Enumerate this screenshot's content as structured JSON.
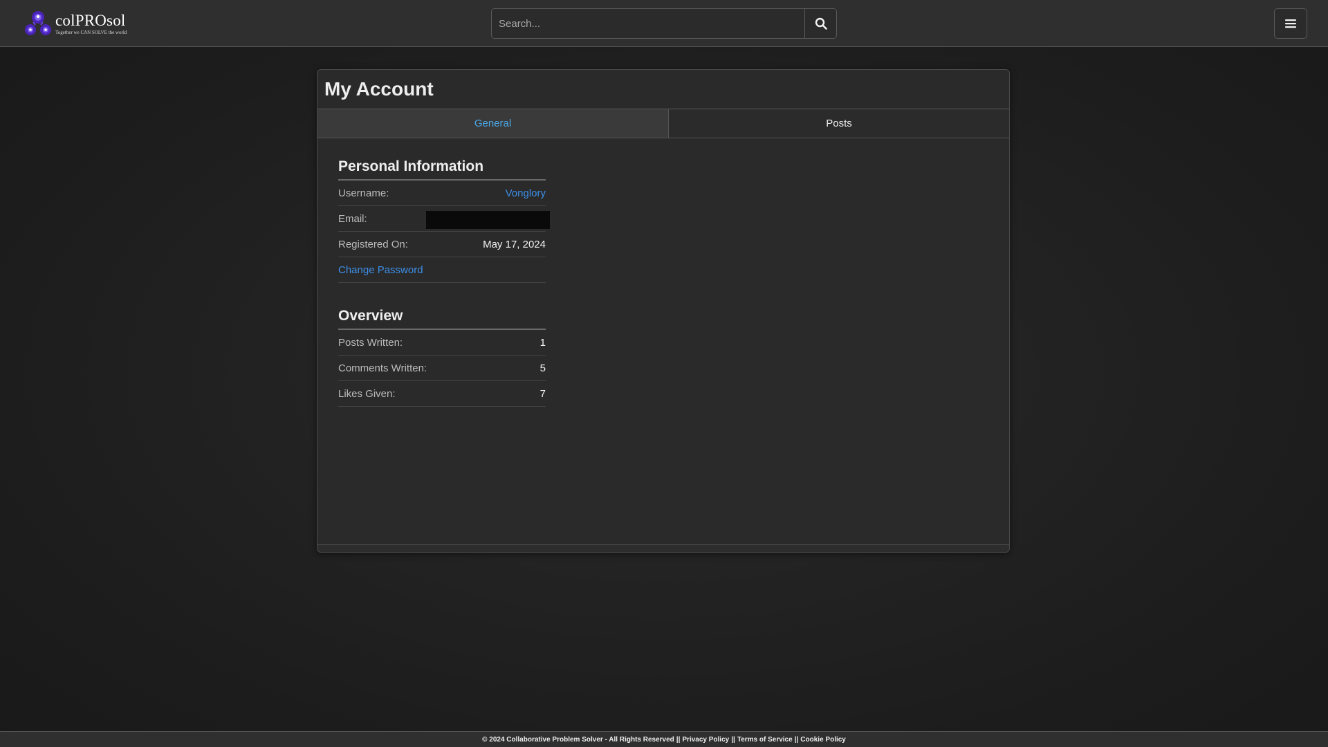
{
  "header": {
    "logo_name": "colPROsol",
    "logo_tagline": "Together we CAN SOLVE the world",
    "search_placeholder": "Search...",
    "search_value": ""
  },
  "account": {
    "title": "My Account",
    "tabs": [
      {
        "label": "General",
        "active": true
      },
      {
        "label": "Posts",
        "active": false
      }
    ],
    "personal": {
      "heading": "Personal Information",
      "username_label": "Username:",
      "username_value": "Vonglory",
      "email_label": "Email:",
      "registered_label": "Registered On:",
      "registered_value": "May 17, 2024",
      "change_password": "Change Password"
    },
    "overview": {
      "heading": "Overview",
      "rows": [
        {
          "label": "Posts Written:",
          "value": "1"
        },
        {
          "label": "Comments Written:",
          "value": "5"
        },
        {
          "label": "Likes Given:",
          "value": "7"
        }
      ]
    }
  },
  "footer": {
    "copyright": "© 2024 Collaborative Problem Solver - All Rights Reserved",
    "separator": "||",
    "links": [
      "Privacy Policy",
      "Terms of Service",
      "Cookie Policy"
    ]
  },
  "colors": {
    "link_blue": "#3d8fe8",
    "active_tab": "#4aa8e8",
    "logo_purple": "#5b2fc9"
  },
  "icons": {
    "search": "search-icon",
    "menu": "hamburger-menu-icon",
    "logo": "logo-icon"
  }
}
